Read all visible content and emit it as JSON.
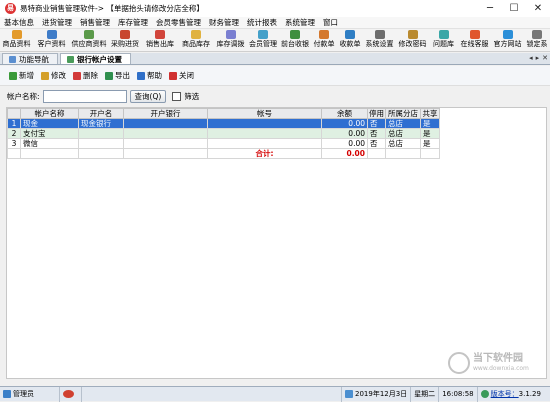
{
  "window": {
    "title": "易特商业销售管理软件-> 【单据抬头请修改分店全称】",
    "buttons": {
      "minimize": "─",
      "maximize": "☐",
      "close": "✕"
    }
  },
  "menubar": [
    "基本信息",
    "进货管理",
    "销售管理",
    "库存管理",
    "会员零售管理",
    "财务管理",
    "统计报表",
    "系统管理",
    "窗口"
  ],
  "toolbar": [
    {
      "label": "商品资料",
      "color": "#e39a2b"
    },
    {
      "label": "客户资料",
      "color": "#3e7cc8"
    },
    {
      "label": "供应商资料",
      "color": "#5b9a4a"
    },
    {
      "label": "采购进货",
      "color": "#c8462f"
    },
    {
      "label": "销售出库",
      "color": "#d1453b"
    },
    {
      "label": "商品库存",
      "color": "#e0b240"
    },
    {
      "label": "库存调拨",
      "color": "#7a7fd1"
    },
    {
      "label": "会员管理",
      "color": "#44a0c9"
    },
    {
      "label": "前台收银",
      "color": "#3f8f3f"
    },
    {
      "label": "付款单",
      "color": "#d4782d"
    },
    {
      "label": "收款单",
      "color": "#2f7ec4"
    },
    {
      "label": "系统设置",
      "color": "#6d6d6d"
    },
    {
      "label": "修改密码",
      "color": "#b98a2f"
    },
    {
      "label": "问题库",
      "color": "#3aa7a7"
    },
    {
      "label": "在线客服",
      "color": "#e0562d"
    },
    {
      "label": "官方网站",
      "color": "#2c8fd8"
    },
    {
      "label": "锁定系",
      "color": "#777777"
    }
  ],
  "tabs": [
    {
      "label": "功能导航",
      "active": false
    },
    {
      "label": "银行帐户设置",
      "active": true
    }
  ],
  "tab_controls": [
    "◂",
    "▸",
    "✕"
  ],
  "actions": [
    {
      "label": "新增",
      "icon": "add-icon",
      "color": "#3a9a3a"
    },
    {
      "label": "修改",
      "icon": "edit-icon",
      "color": "#d4a02a"
    },
    {
      "label": "删除",
      "icon": "delete-icon",
      "color": "#d23a3a"
    },
    {
      "label": "导出",
      "icon": "export-icon",
      "color": "#2f8f4f"
    },
    {
      "label": "帮助",
      "icon": "help-icon",
      "color": "#2f6fc8"
    },
    {
      "label": "关闭",
      "icon": "close-icon",
      "color": "#d03030"
    }
  ],
  "search": {
    "label": "帐户名称:",
    "value": "",
    "query_label": "查询(Q)",
    "filter_label": "筛选"
  },
  "table": {
    "columns": [
      "",
      "帐户名称",
      "开户名",
      "开户银行",
      "帐号",
      "余额",
      "停用",
      "所属分店",
      "共享"
    ],
    "rows": [
      [
        "1",
        "现金",
        "现金银行",
        "",
        "",
        "0.00",
        "否",
        "总店",
        "是"
      ],
      [
        "2",
        "支付宝",
        "",
        "",
        "",
        "0.00",
        "否",
        "总店",
        "是"
      ],
      [
        "3",
        "微信",
        "",
        "",
        "",
        "0.00",
        "否",
        "总店",
        "是"
      ]
    ],
    "selected_row": 0,
    "total_label": "合计:",
    "total_value": "0.00"
  },
  "watermark": {
    "name": "当下软件园",
    "url": "www.downxia.com"
  },
  "statusbar": {
    "user": "管理员",
    "date": "2019年12月3日",
    "weekday": "星期二",
    "time": "16:08:58",
    "version_link": "版本号：",
    "version_num": "3.1.29"
  },
  "colors": {
    "selected_row": "#2f6fd1",
    "alt_row": "#dff0e2",
    "total_red": "#d40000"
  }
}
